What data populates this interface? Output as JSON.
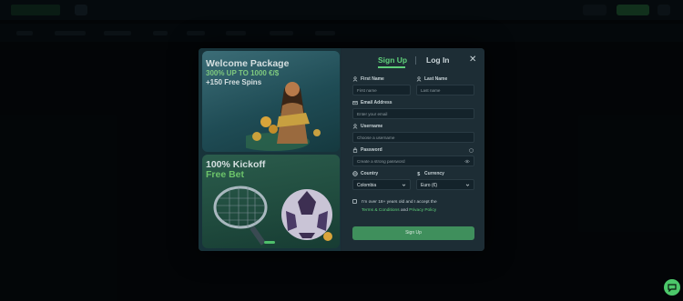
{
  "promo": {
    "card1": {
      "title": "Welcome Package",
      "line1": "300% UP TO 1000 €/$",
      "line2": "+150 Free Spins"
    },
    "card2": {
      "title": "100% Kickoff",
      "subtitle": "Free Bet"
    }
  },
  "tabs": {
    "signup": "Sign Up",
    "login": "Log In"
  },
  "close": "✕",
  "fields": {
    "first_name": {
      "label": "First Name",
      "placeholder": "First name"
    },
    "last_name": {
      "label": "Last Name",
      "placeholder": "Last name"
    },
    "email": {
      "label": "Email Address",
      "placeholder": "Enter your email"
    },
    "username": {
      "label": "Username",
      "placeholder": "Choose a username"
    },
    "password": {
      "label": "Password",
      "placeholder": "Create a strong password"
    },
    "country": {
      "label": "Country",
      "value": "Colombia"
    },
    "currency": {
      "label": "Currency",
      "value": "Euro (€)"
    }
  },
  "agree": {
    "text": "I'm over 18+ years old and I accept the",
    "terms": "Terms & Conditions",
    "and": "and",
    "privacy": "Privacy Policy"
  },
  "submit": "Sign Up",
  "colors": {
    "accent": "#5fd07a",
    "button": "#3f8f5c",
    "modal_bg": "#1d2d35"
  }
}
